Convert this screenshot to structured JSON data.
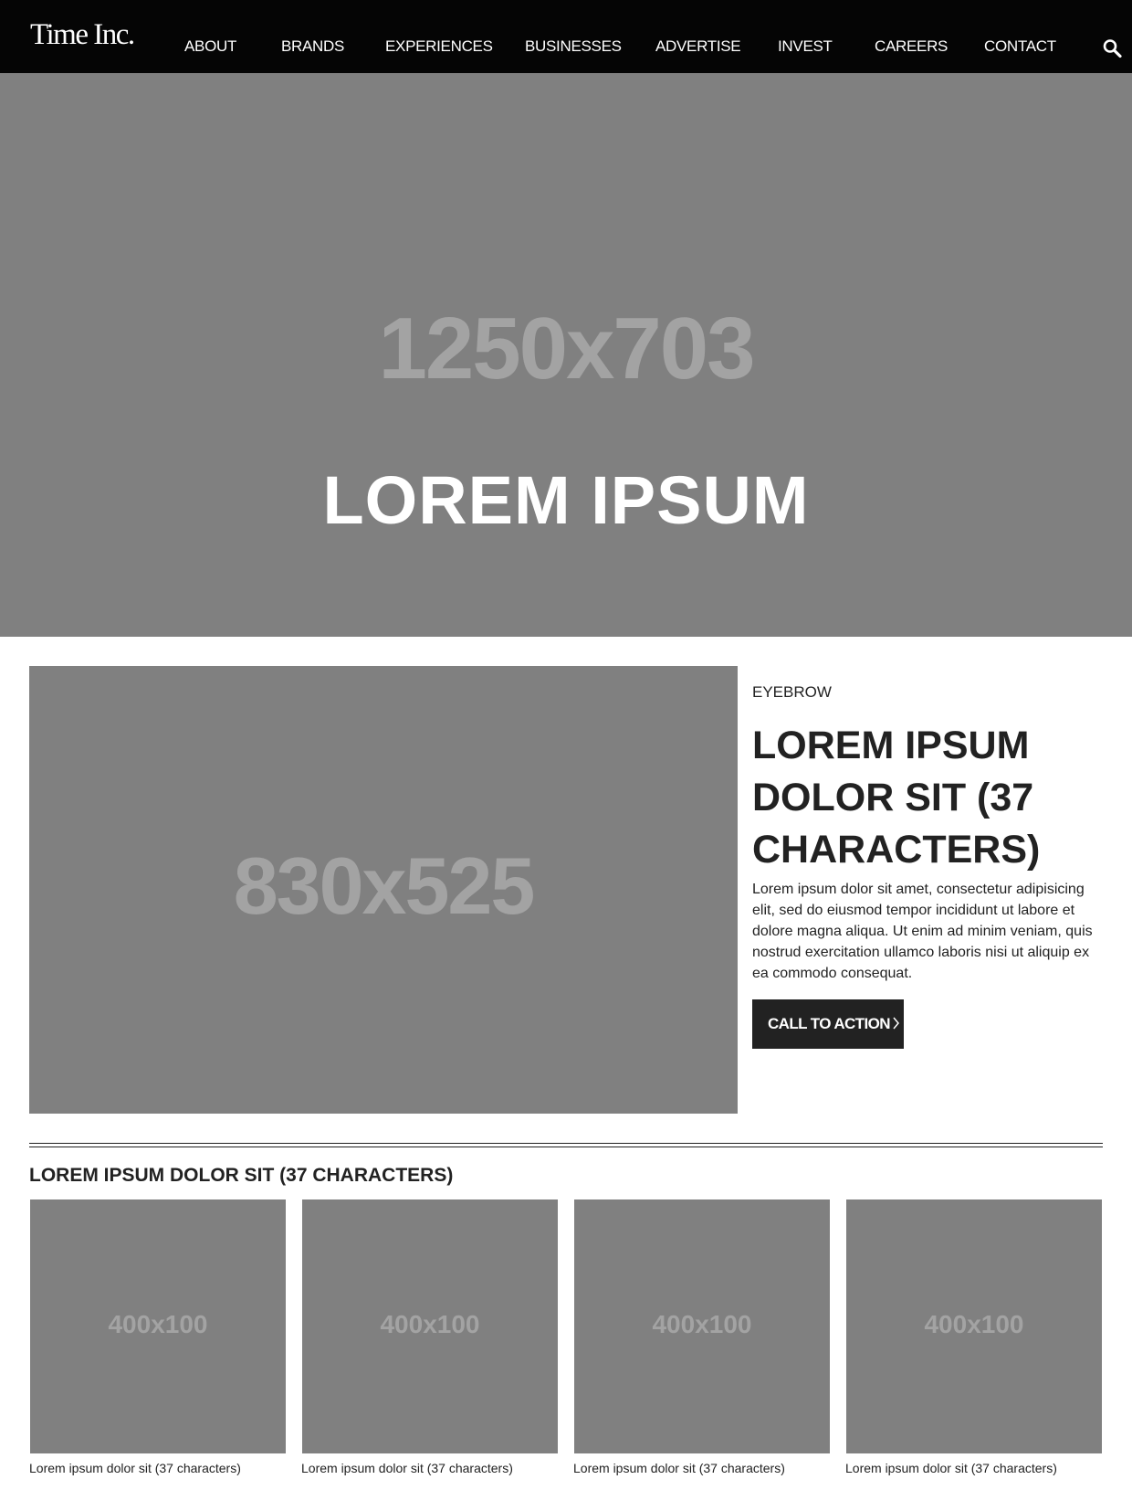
{
  "header": {
    "logo": "Time Inc.",
    "nav": [
      "ABOUT",
      "BRANDS",
      "EXPERIENCES",
      "BUSINESSES",
      "ADVERTISE",
      "INVEST",
      "CAREERS",
      "CONTACT"
    ],
    "search_icon": "search-icon"
  },
  "hero": {
    "image_label": "1250x703",
    "title": "LOREM IPSUM"
  },
  "feature": {
    "image_label": "830x525",
    "eyebrow": "EYEBROW",
    "title": "LOREM IPSUM DOLOR SIT (37 CHARACTERS)",
    "body": "Lorem ipsum dolor sit amet, consectetur adipisicing elit, sed do eiusmod tempor incididunt ut labore et dolore magna aliqua. Ut enim ad minim veniam, quis nostrud exercitation ullamco laboris nisi ut aliquip ex ea commodo consequat.",
    "cta": "CALL TO ACTION",
    "cta_icon": "chevron-right-icon"
  },
  "section": {
    "title": "LOREM IPSUM DOLOR SIT (37 CHARACTERS)",
    "cards": [
      {
        "image_label": "400x100",
        "caption": "Lorem ipsum dolor sit (37 characters)"
      },
      {
        "image_label": "400x100",
        "caption": "Lorem ipsum dolor sit (37 characters)"
      },
      {
        "image_label": "400x100",
        "caption": "Lorem ipsum dolor sit (37 characters)"
      },
      {
        "image_label": "400x100",
        "caption": "Lorem ipsum dolor sit (37 characters)"
      }
    ]
  },
  "colors": {
    "nav_bg": "#050505",
    "placeholder": "#808080",
    "placeholder_text": "#a3a3a3",
    "cta_bg": "#222222"
  }
}
